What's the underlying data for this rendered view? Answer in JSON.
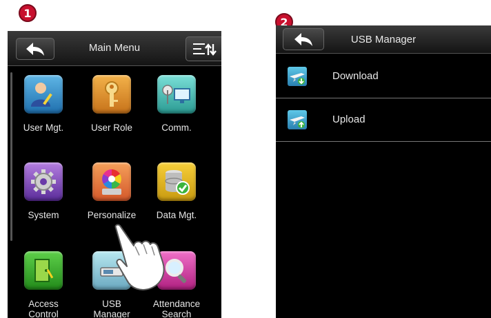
{
  "steps": [
    "1",
    "2"
  ],
  "main_menu": {
    "title": "Main Menu",
    "items": [
      {
        "label": "User Mgt.",
        "icon": "user-mgt-icon"
      },
      {
        "label": "User Role",
        "icon": "key-icon"
      },
      {
        "label": "Comm.",
        "icon": "network-icon"
      },
      {
        "label": "System",
        "icon": "gear-icon"
      },
      {
        "label": "Personalize",
        "icon": "color-wheel-icon"
      },
      {
        "label": "Data Mgt.",
        "icon": "database-icon"
      },
      {
        "label": "Access\nControl",
        "icon": "door-icon"
      },
      {
        "label": "USB\nManager",
        "icon": "usb-drive-icon"
      },
      {
        "label": "Attendance\nSearch",
        "icon": "magnifier-icon"
      }
    ]
  },
  "usb_manager": {
    "title": "USB Manager",
    "items": [
      {
        "label": "Download",
        "icon": "download-icon"
      },
      {
        "label": "Upload",
        "icon": "upload-icon"
      }
    ]
  }
}
